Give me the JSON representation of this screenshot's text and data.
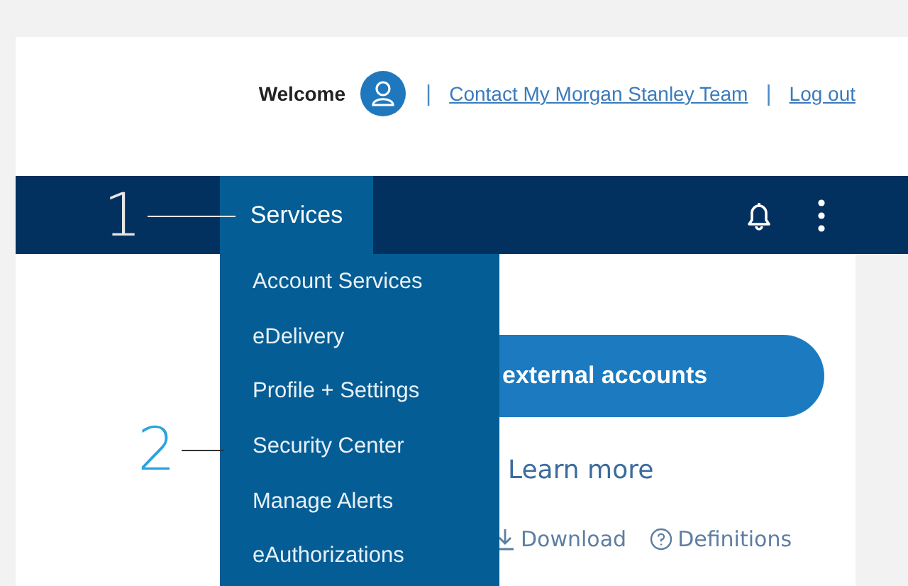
{
  "header": {
    "welcome": "Welcome",
    "separators": [
      "|",
      "|"
    ],
    "links": [
      "Contact My Morgan Stanley Team",
      "Log out"
    ]
  },
  "nav": {
    "tab": {
      "label": "Services",
      "expanded": true
    },
    "menu": [
      "Account Services",
      "eDelivery",
      "Profile + Settings",
      "Security Center",
      "Manage Alerts",
      "eAuthorizations"
    ]
  },
  "callouts": [
    {
      "number": "1",
      "color": "#e6e6e6"
    },
    {
      "number": "2",
      "color": "#2aa3de"
    }
  ],
  "content": {
    "pill_button": "external accounts",
    "learn_more": "Learn more",
    "actions": [
      {
        "kind": "download",
        "label": "Download"
      },
      {
        "kind": "help",
        "label": "Definitions"
      }
    ]
  }
}
